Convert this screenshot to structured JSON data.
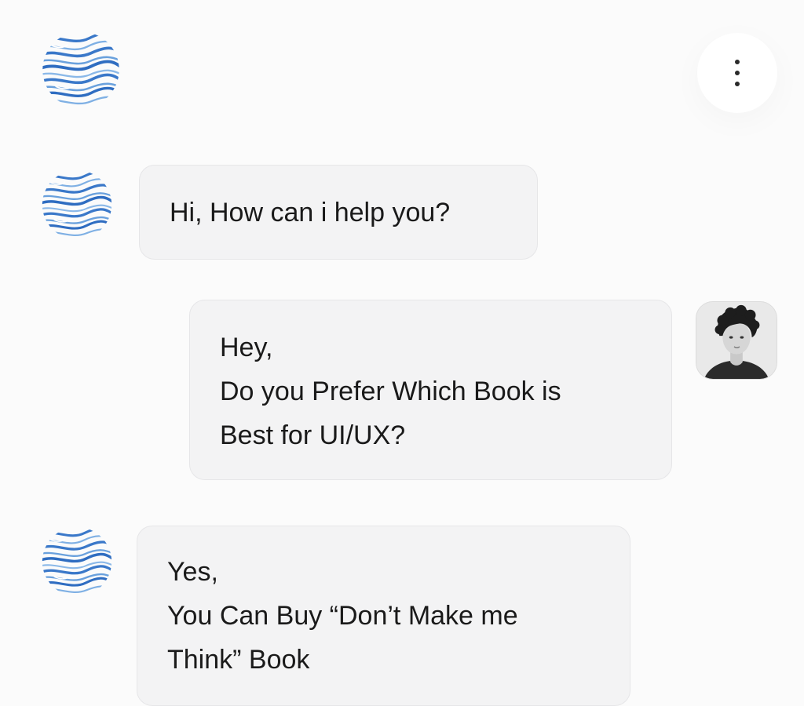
{
  "header": {
    "logo_icon": "wave-orb-logo-icon",
    "menu_icon": "more-vertical-icon"
  },
  "colors": {
    "logo_blue": "#3a78c9",
    "logo_light_blue": "#7fb0e4",
    "bubble_bg": "#f3f3f4",
    "page_bg": "#fbfbfb"
  },
  "messages": [
    {
      "sender": "bot",
      "avatar_icon": "wave-orb-logo-icon",
      "lines": [
        "Hi, How can i help you?"
      ]
    },
    {
      "sender": "user",
      "avatar_icon": "user-avatar-photo",
      "lines": [
        "Hey,",
        "Do you Prefer Which Book is",
        "Best for UI/UX?"
      ]
    },
    {
      "sender": "bot",
      "avatar_icon": "wave-orb-logo-icon",
      "lines": [
        "Yes,",
        "You Can Buy “Don’t Make me",
        "Think” Book"
      ]
    }
  ]
}
